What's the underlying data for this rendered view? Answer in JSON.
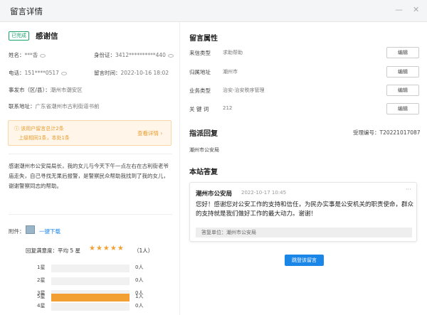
{
  "window": {
    "title": "留言详情",
    "minimize": "—",
    "close": "✕"
  },
  "letter": {
    "status_tag": "已完成",
    "title": "感谢信",
    "name_label": "姓名：",
    "name_value": "***香",
    "idcard_label": "身份证：",
    "idcard_value": "3412**********440",
    "phone_label": "电话：",
    "phone_value": "151****0517",
    "time_label": "留言时间：",
    "time_value": "2022-10-16 18:02",
    "location_label": "事发市（区/县）：",
    "location_value": "潮州市潮安区",
    "address_label": "联系地址：",
    "address_value": "广东省潮州市古利街道书前"
  },
  "notice": {
    "line1": "该用户留言总计2条",
    "line2": "上级相同1条，本处1条",
    "more": "查看详情 ›"
  },
  "content": "感谢潮州市公安局局长，我的女儿与今天下午一点左右在古利街老爷庙走失，自己寻找无果后报警，是警察民众帮助我找到了我的女儿，谢谢警察同志的帮助。",
  "attachment": {
    "label": "附件：",
    "link": "一键下载"
  },
  "rating": {
    "head": "回复满意度：平均 5 星",
    "stars": "★★★★★",
    "count": "（1人）",
    "rows": [
      {
        "label": "1星",
        "count": "0人",
        "fraction": 0
      },
      {
        "label": "2星",
        "count": "0人",
        "fraction": 0
      },
      {
        "label": "3星",
        "count": "0人",
        "fraction": 0
      },
      {
        "label": "4星",
        "count": "0人",
        "fraction": 0
      },
      {
        "label": "5星",
        "count": "1人",
        "fraction": 1
      }
    ]
  },
  "props": {
    "section": "留言属性",
    "rows": [
      {
        "key": "来信类型",
        "value": "求助帮助",
        "button": "编辑"
      },
      {
        "key": "归属地址",
        "value": "潮州市",
        "button": "编辑"
      },
      {
        "key": "业务类型",
        "value": "治安-治安秩序管理",
        "button": "编辑"
      },
      {
        "key": "关 键 词",
        "value": "212",
        "button": "编辑"
      }
    ]
  },
  "assign": {
    "section": "指派回复",
    "id_label": "受理编号：",
    "id_value": "T20221017087",
    "unit": "潮州市公安局"
  },
  "reply": {
    "section": "本站答复",
    "author": "潮州市公安局",
    "time": "2022-10-17 10:45",
    "menu": "···",
    "text": "您好！感谢您对公安工作的支持和信任，为民办实事是公安机关的职责使命，群众的支持就是我们做好工作的最大动力。谢谢！",
    "unit_label": "答复单位：",
    "unit_value": "潮州市公安局"
  },
  "action": {
    "jump": "跳登该留言"
  },
  "colors": {
    "accent": "#1a86e8",
    "success": "#1aa36b",
    "warning": "#f2a033"
  }
}
